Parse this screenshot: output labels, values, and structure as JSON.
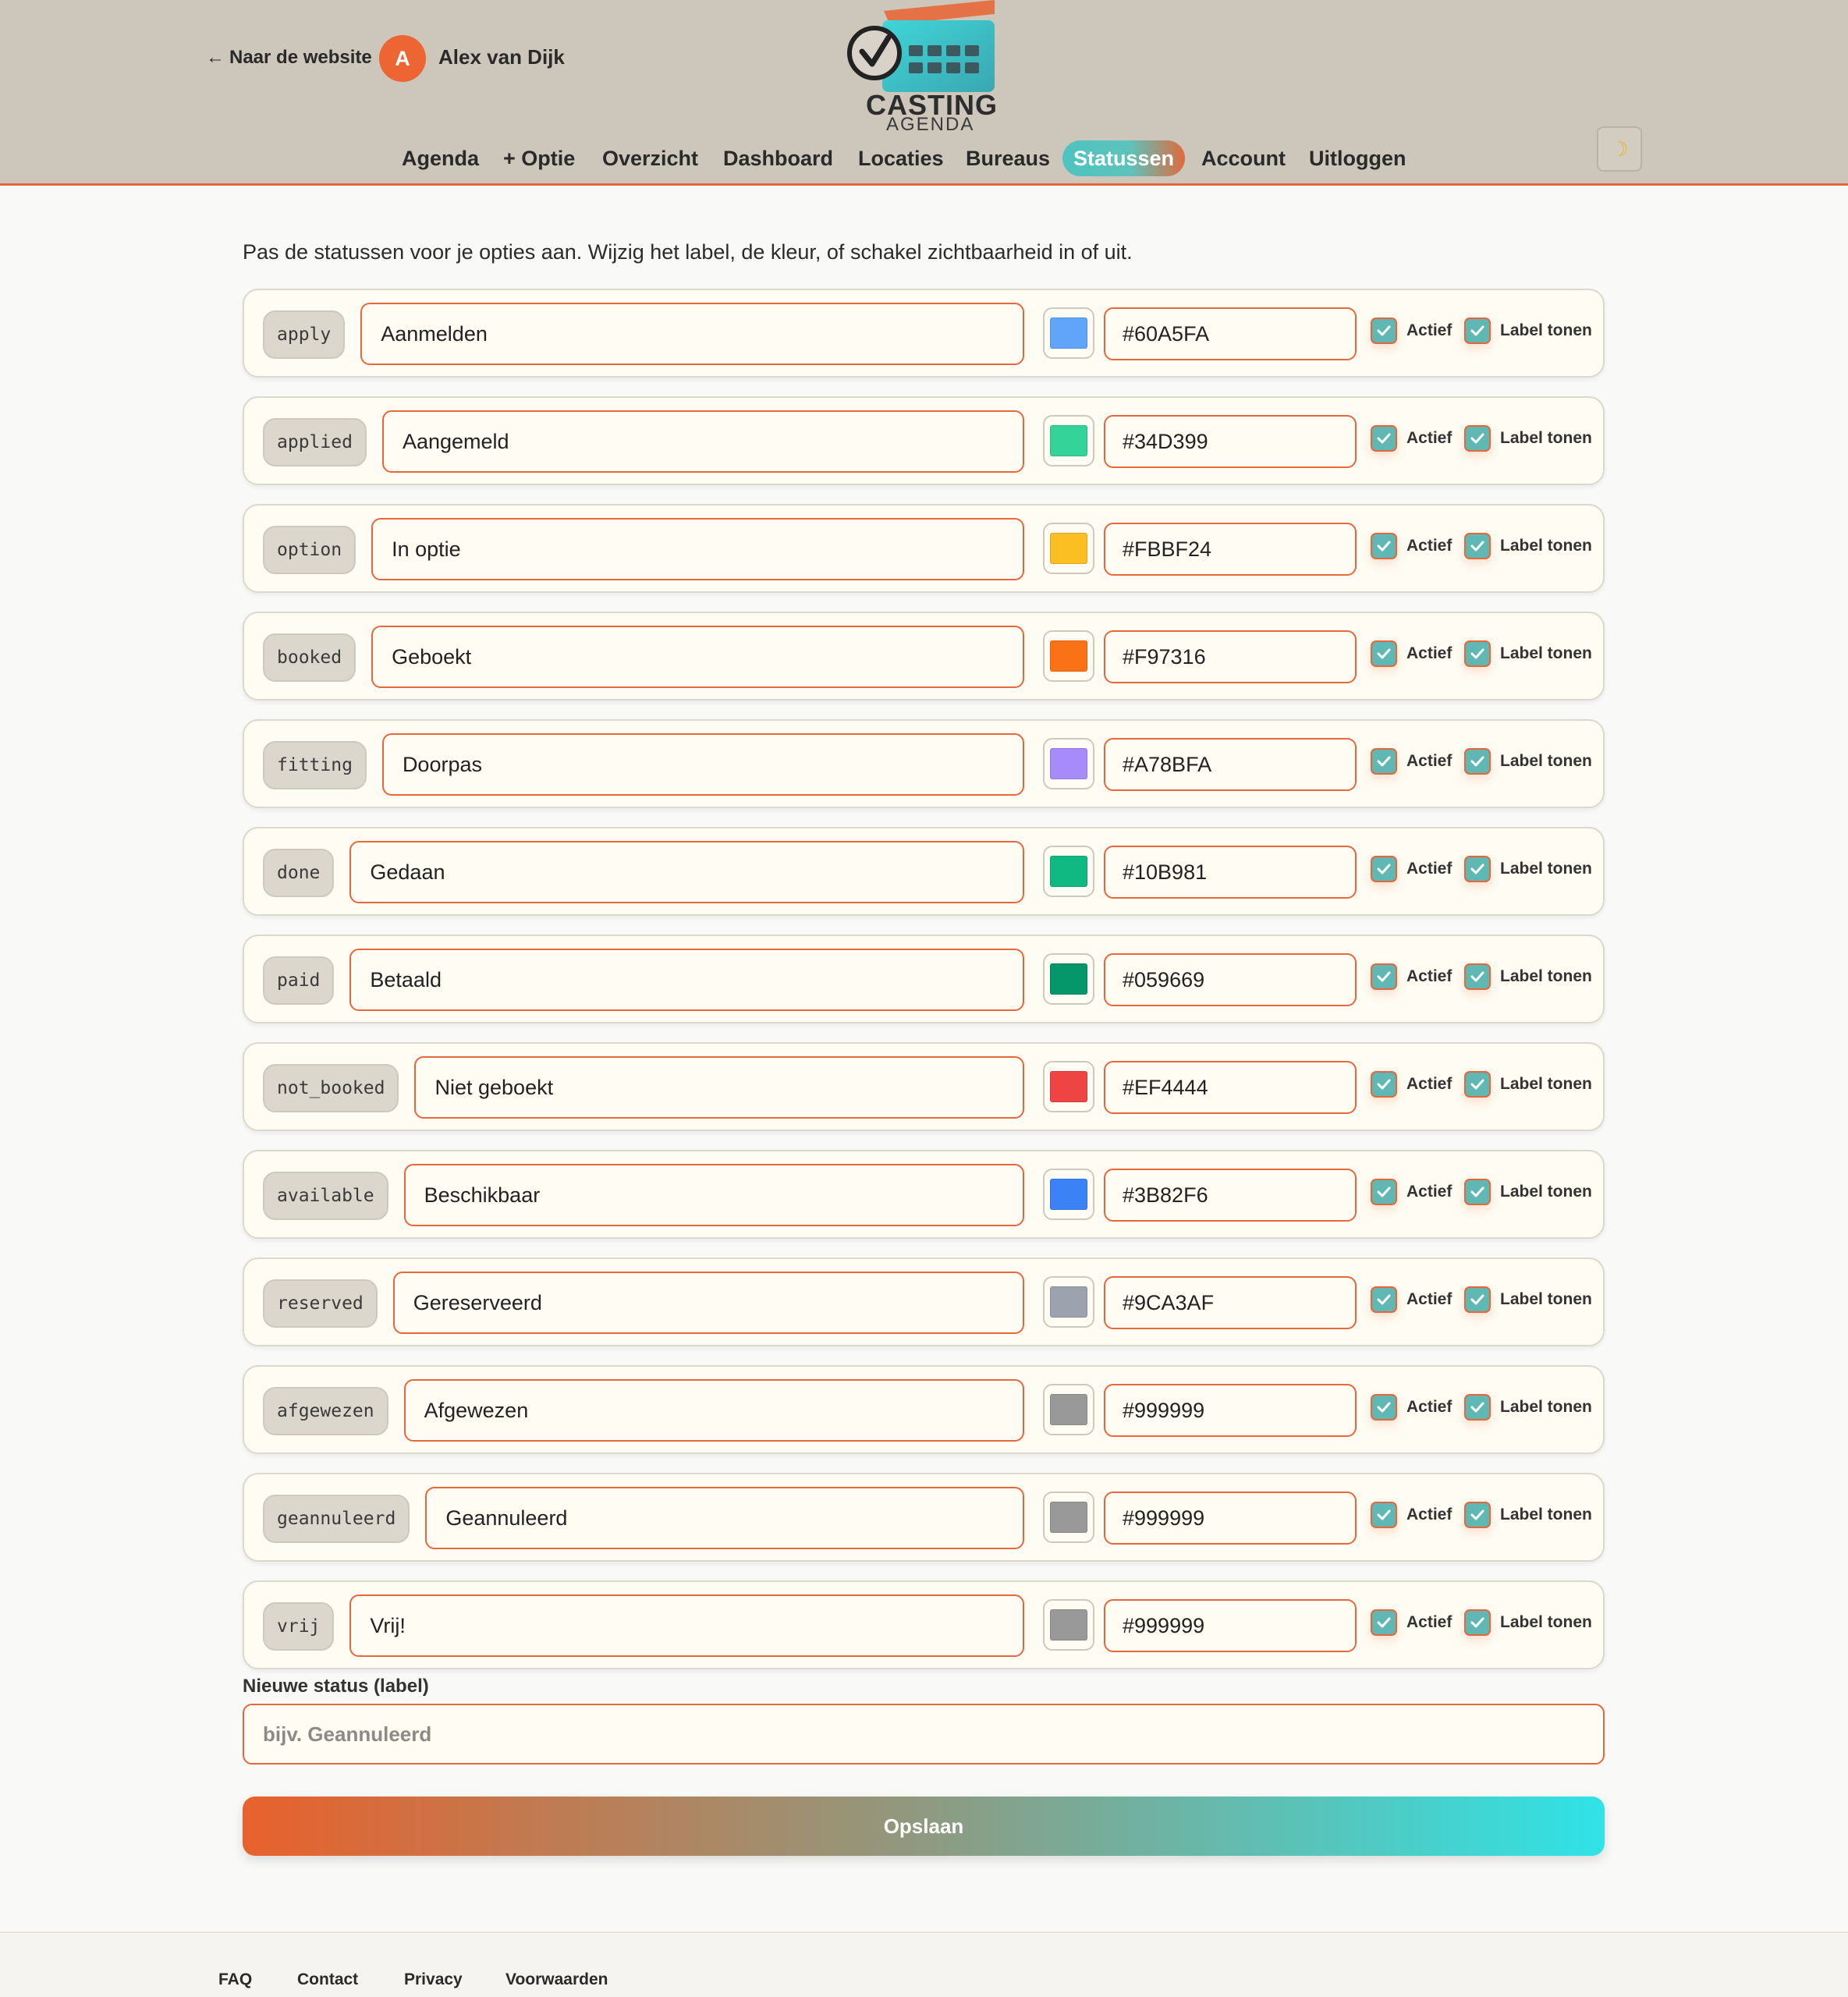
{
  "header": {
    "back_link": "Naar de website",
    "back_arrow": "←",
    "avatar_initial": "A",
    "user_name": "Alex van Dijk",
    "logo_line1": "CASTING",
    "logo_line2": "AGENDA",
    "theme_icon": "moon-icon",
    "nav": [
      "Agenda",
      "+ Optie",
      "Overzicht",
      "Dashboard",
      "Locaties",
      "Bureaus",
      "Statussen",
      "Account",
      "Uitloggen"
    ],
    "active_nav": "Statussen"
  },
  "intro": "Pas de statussen voor je opties aan. Wijzig het label, de kleur, of schakel zichtbaarheid in of uit.",
  "toggle_labels": {
    "active": "Actief",
    "show_label": "Label tonen"
  },
  "statuses": [
    {
      "key": "apply",
      "label": "Aanmelden",
      "color": "#60A5FA",
      "active": true,
      "show_label": true
    },
    {
      "key": "applied",
      "label": "Aangemeld",
      "color": "#34D399",
      "active": true,
      "show_label": true
    },
    {
      "key": "option",
      "label": "In optie",
      "color": "#FBBF24",
      "active": true,
      "show_label": true
    },
    {
      "key": "booked",
      "label": "Geboekt",
      "color": "#F97316",
      "active": true,
      "show_label": true
    },
    {
      "key": "fitting",
      "label": "Doorpas",
      "color": "#A78BFA",
      "active": true,
      "show_label": true
    },
    {
      "key": "done",
      "label": "Gedaan",
      "color": "#10B981",
      "active": true,
      "show_label": true
    },
    {
      "key": "paid",
      "label": "Betaald",
      "color": "#059669",
      "active": true,
      "show_label": true
    },
    {
      "key": "not_booked",
      "label": "Niet geboekt",
      "color": "#EF4444",
      "active": true,
      "show_label": true
    },
    {
      "key": "available",
      "label": "Beschikbaar",
      "color": "#3B82F6",
      "active": true,
      "show_label": true
    },
    {
      "key": "reserved",
      "label": "Gereserveerd",
      "color": "#9CA3AF",
      "active": true,
      "show_label": true
    },
    {
      "key": "afgewezen",
      "label": "Afgewezen",
      "color": "#999999",
      "active": true,
      "show_label": true
    },
    {
      "key": "geannuleerd",
      "label": "Geannuleerd",
      "color": "#999999",
      "active": true,
      "show_label": true
    },
    {
      "key": "vrij",
      "label": "Vrij!",
      "color": "#999999",
      "active": true,
      "show_label": true
    }
  ],
  "new_status": {
    "label": "Nieuwe status (label)",
    "placeholder": "bijv. Geannuleerd"
  },
  "save_label": "Opslaan",
  "footer": [
    "FAQ",
    "Contact",
    "Privacy",
    "Voorwaarden"
  ],
  "colors": {
    "accent": "#e8673a",
    "header_bg": "#cdc6bb",
    "teal": "#5fb8b3"
  }
}
